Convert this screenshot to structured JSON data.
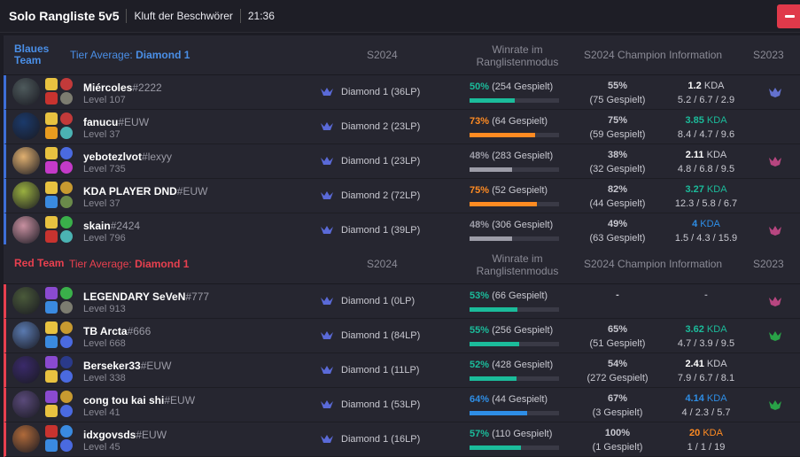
{
  "header": {
    "title": "Solo Rangliste 5v5",
    "map": "Kluft der Beschwörer",
    "time": "21:36"
  },
  "columns": {
    "season": "S2024",
    "winrate_line1": "Winrate im",
    "winrate_line2": "Ranglistenmodus",
    "champion": "S2024 Champion Information",
    "prev_season": "S2023"
  },
  "colors": {
    "teal": "#1bbc9b",
    "orange": "#ff8b22",
    "gray": "#9d9da8",
    "blue": "#2e8ee6",
    "blue_team": "#4a8fe7",
    "red_team": "#e8404f"
  },
  "blue_team": {
    "name": "Blaues Team",
    "tier_label": "Tier Average:",
    "tier_value": "Diamond 1",
    "players": [
      {
        "name": "Miércoles",
        "tag": "#2222",
        "level": "Level 107",
        "rank": "Diamond 1 (36LP)",
        "winrate_pct": "50%",
        "winrate_games": "(254 Gespielt)",
        "wr_value": 50,
        "wr_color": "teal",
        "champ_wr": "55%",
        "champ_games": "(75 Gespielt)",
        "kda_value": "1.2",
        "kda_suffix": "KDA",
        "kda_color": "white",
        "kda_detail": "5.2 / 6.7 / 2.9",
        "s2023_icon": "diamond-emblem-icon",
        "avatar": "#4e5a5c",
        "spells": [
          "#e8c240",
          "#c8332f"
        ],
        "runes": [
          "#c23a3a",
          "#7c7c70"
        ]
      },
      {
        "name": "fanucu",
        "tag": "#EUW",
        "level": "Level 37",
        "rank": "Diamond 2 (23LP)",
        "winrate_pct": "73%",
        "winrate_games": "(64 Gespielt)",
        "wr_value": 73,
        "wr_color": "orange",
        "champ_wr": "75%",
        "champ_games": "(59 Gespielt)",
        "kda_value": "3.85",
        "kda_suffix": "KDA",
        "kda_color": "teal",
        "kda_detail": "8.4 / 4.7 / 9.6",
        "s2023_icon": "",
        "avatar": "#1b3a6b",
        "spells": [
          "#e8c240",
          "#e89b1f"
        ],
        "runes": [
          "#c23a3a",
          "#4bb3b3"
        ]
      },
      {
        "name": "yebotezlvot",
        "tag": "#lexyy",
        "level": "Level 735",
        "rank": "Diamond 1 (23LP)",
        "winrate_pct": "48%",
        "winrate_games": "(283 Gespielt)",
        "wr_value": 48,
        "wr_color": "gray",
        "champ_wr": "38%",
        "champ_games": "(32 Gespielt)",
        "kda_value": "2.11",
        "kda_suffix": "KDA",
        "kda_color": "white",
        "kda_detail": "4.8 / 6.8 / 9.5",
        "s2023_icon": "master-emblem-icon",
        "avatar": "#e0b070",
        "spells": [
          "#e8c240",
          "#c43ac8"
        ],
        "runes": [
          "#4a6ae0",
          "#c43ac8"
        ]
      },
      {
        "name": "KDA PLAYER DND",
        "tag": "#EUW",
        "level": "Level 37",
        "rank": "Diamond 2 (72LP)",
        "winrate_pct": "75%",
        "winrate_games": "(52 Gespielt)",
        "wr_value": 75,
        "wr_color": "orange",
        "champ_wr": "82%",
        "champ_games": "(44 Gespielt)",
        "kda_value": "3.27",
        "kda_suffix": "KDA",
        "kda_color": "teal",
        "kda_detail": "12.3 / 5.8 / 6.7",
        "s2023_icon": "",
        "avatar": "#9ab040",
        "spells": [
          "#e8c240",
          "#3a8ae0"
        ],
        "runes": [
          "#c89a30",
          "#6a8a4a"
        ]
      },
      {
        "name": "skain",
        "tag": "#2424",
        "level": "Level 796",
        "rank": "Diamond 1 (39LP)",
        "winrate_pct": "48%",
        "winrate_games": "(306 Gespielt)",
        "wr_value": 48,
        "wr_color": "gray",
        "champ_wr": "49%",
        "champ_games": "(63 Gespielt)",
        "kda_value": "4",
        "kda_suffix": "KDA",
        "kda_color": "blue",
        "kda_detail": "1.5 / 4.3 / 15.9",
        "s2023_icon": "master-emblem-icon",
        "avatar": "#c890a0",
        "spells": [
          "#e8c240",
          "#c8332f"
        ],
        "runes": [
          "#3ab04a",
          "#4bb3b3"
        ]
      }
    ]
  },
  "red_team": {
    "name": "Red Team",
    "tier_label": "Tier Average:",
    "tier_value": "Diamond 1",
    "players": [
      {
        "name": "LEGENDARY SeVeN",
        "tag": "#777",
        "level": "Level 913",
        "rank": "Diamond 1 (0LP)",
        "winrate_pct": "53%",
        "winrate_games": "(66 Gespielt)",
        "wr_value": 53,
        "wr_color": "teal",
        "champ_wr": "-",
        "champ_games": "",
        "kda_value": "-",
        "kda_suffix": "",
        "kda_color": "gray",
        "kda_detail": "",
        "s2023_icon": "master-emblem-icon",
        "avatar": "#4a5a3a",
        "spells": [
          "#8a4ad0",
          "#3a8ae0"
        ],
        "runes": [
          "#3ab04a",
          "#7c7c70"
        ]
      },
      {
        "name": "TB Arcta",
        "tag": "#666",
        "level": "Level 668",
        "rank": "Diamond 1 (84LP)",
        "winrate_pct": "55%",
        "winrate_games": "(256 Gespielt)",
        "wr_value": 55,
        "wr_color": "teal",
        "champ_wr": "65%",
        "champ_games": "(51 Gespielt)",
        "kda_value": "3.62",
        "kda_suffix": "KDA",
        "kda_color": "teal",
        "kda_detail": "4.7 / 3.9 / 9.5",
        "s2023_icon": "emerald-emblem-icon",
        "avatar": "#5a7ab0",
        "spells": [
          "#e8c240",
          "#3a8ae0"
        ],
        "runes": [
          "#c89a30",
          "#4a6ae0"
        ]
      },
      {
        "name": "Berseker33",
        "tag": "#EUW",
        "level": "Level 338",
        "rank": "Diamond 1 (11LP)",
        "winrate_pct": "52%",
        "winrate_games": "(428 Gespielt)",
        "wr_value": 52,
        "wr_color": "teal",
        "champ_wr": "54%",
        "champ_games": "(272 Gespielt)",
        "kda_value": "2.41",
        "kda_suffix": "KDA",
        "kda_color": "white",
        "kda_detail": "7.9 / 6.7 / 8.1",
        "s2023_icon": "",
        "avatar": "#3a2a6a",
        "spells": [
          "#8a4ad0",
          "#e8c240"
        ],
        "runes": [
          "#2a3a8a",
          "#4a6ae0"
        ]
      },
      {
        "name": "cong tou kai shi",
        "tag": "#EUW",
        "level": "Level 41",
        "rank": "Diamond 1 (53LP)",
        "winrate_pct": "64%",
        "winrate_games": "(44 Gespielt)",
        "wr_value": 64,
        "wr_color": "blue",
        "champ_wr": "67%",
        "champ_games": "(3 Gespielt)",
        "kda_value": "4.14",
        "kda_suffix": "KDA",
        "kda_color": "blue",
        "kda_detail": "4 / 2.3 / 5.7",
        "s2023_icon": "emerald-emblem-icon",
        "avatar": "#5a4a7a",
        "spells": [
          "#8a4ad0",
          "#e8c240"
        ],
        "runes": [
          "#c89a30",
          "#4a6ae0"
        ]
      },
      {
        "name": "idxgovsds",
        "tag": "#EUW",
        "level": "Level 45",
        "rank": "Diamond 1 (16LP)",
        "winrate_pct": "57%",
        "winrate_games": "(110 Gespielt)",
        "wr_value": 57,
        "wr_color": "teal",
        "champ_wr": "100%",
        "champ_games": "(1 Gespielt)",
        "kda_value": "20",
        "kda_suffix": "KDA",
        "kda_color": "orange",
        "kda_detail": "1 / 1 / 19",
        "s2023_icon": "",
        "avatar": "#b06a3a",
        "spells": [
          "#c8332f",
          "#3a8ae0"
        ],
        "runes": [
          "#3a8ae0",
          "#4a6ae0"
        ]
      }
    ]
  }
}
